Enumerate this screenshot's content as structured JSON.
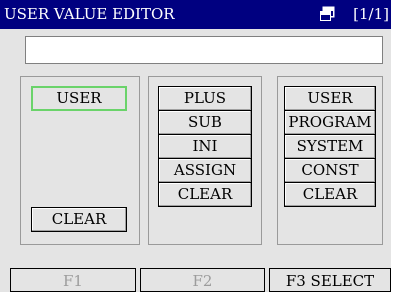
{
  "title": "USER VALUE EDITOR",
  "page_indicator": "[1/1]",
  "value_field": "",
  "groups": [
    {
      "buttons": [
        "USER",
        "CLEAR"
      ]
    },
    {
      "buttons": [
        "PLUS",
        "SUB",
        "INI",
        "ASSIGN",
        "CLEAR"
      ]
    },
    {
      "buttons": [
        "USER",
        "PROGRAM",
        "SYSTEM",
        "CONST",
        "CLEAR"
      ]
    }
  ],
  "fkeys": [
    "F1",
    "F2",
    "F3 SELECT"
  ],
  "colors": {
    "titlebar": "#000080",
    "background": "#e4e4e4",
    "selected_border": "#6ad36a",
    "disabled_text": "#9c9c9c"
  },
  "icons": {
    "page": "page-window-icon"
  }
}
